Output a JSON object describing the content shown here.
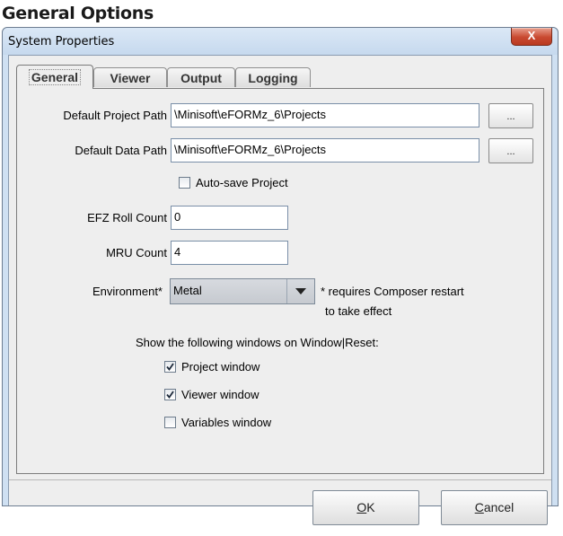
{
  "page_heading": "General Options",
  "window": {
    "title": "System Properties",
    "close_glyph": "X"
  },
  "tabs": [
    {
      "label": "General",
      "active": true
    },
    {
      "label": "Viewer",
      "active": false
    },
    {
      "label": "Output",
      "active": false
    },
    {
      "label": "Logging",
      "active": false
    }
  ],
  "general": {
    "project_path": {
      "label": "Default Project Path",
      "value": "\\Minisoft\\eFORMz_6\\Projects",
      "browse_label": "..."
    },
    "data_path": {
      "label": "Default Data Path",
      "value": "\\Minisoft\\eFORMz_6\\Projects",
      "browse_label": "..."
    },
    "autosave": {
      "label": "Auto-save Project",
      "checked": false
    },
    "roll_count": {
      "label": "EFZ Roll Count",
      "value": "0"
    },
    "mru_count": {
      "label": "MRU Count",
      "value": "4"
    },
    "environment": {
      "label": "Environment*",
      "value": "Metal",
      "note_line1": "* requires Composer restart",
      "note_line2": "to take effect"
    },
    "show_windows_heading": "Show the following windows on Window|Reset:",
    "windows": [
      {
        "label": "Project window",
        "checked": true
      },
      {
        "label": "Viewer window",
        "checked": true
      },
      {
        "label": "Variables window",
        "checked": false
      }
    ]
  },
  "buttons": {
    "ok_mnemonic": "O",
    "ok_rest": "K",
    "cancel_mnemonic": "C",
    "cancel_rest": "ancel"
  },
  "colors": {
    "title_bar": "#cfe0f2",
    "close_button": "#c94a31",
    "client_bg": "#eeeeee"
  },
  "icons": {
    "close": "close-icon",
    "check": "checkmark-icon",
    "dropdown": "chevron-down-icon"
  }
}
